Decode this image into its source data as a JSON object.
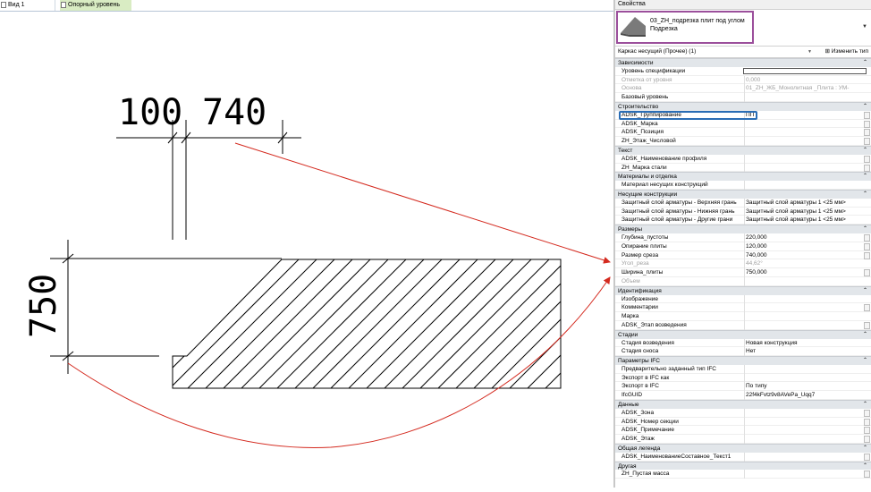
{
  "tabs": [
    {
      "label": "Вид 1"
    },
    {
      "label": "Опорный уровень"
    }
  ],
  "drawing": {
    "dim_top_left": "100",
    "dim_top_right": "740",
    "dim_left": "750"
  },
  "properties": {
    "title": "Свойства",
    "type_selector": {
      "family": "03_ZH_подрезка плит под углом",
      "type": "Подрезка"
    },
    "instance_filter": "Каркас несущий (Прочее) (1)",
    "edit_type": "Изменить тип",
    "groups": [
      {
        "name": "Зависимости",
        "rows": [
          {
            "label": "Уровень спецификации",
            "value": "",
            "input": true
          },
          {
            "label": "Отметка от уровня",
            "value": "0,000",
            "dim": true
          },
          {
            "label": "Основа",
            "value": "01_ZH_ЖБ_Монолитная _Плита : УМ-",
            "dim": true
          },
          {
            "label": "Базовый уровень",
            "value": ""
          }
        ]
      },
      {
        "name": "Строительство",
        "rows": [
          {
            "label": "ADSK_Группирование",
            "value": "ПП",
            "highlight": true,
            "chk": true
          },
          {
            "label": "ADSK_Марка",
            "value": "",
            "chk": true
          },
          {
            "label": "ADSK_Позиция",
            "value": "",
            "chk": true
          },
          {
            "label": "ZH_Этаж_Числовой",
            "value": "",
            "chk": true
          }
        ]
      },
      {
        "name": "Текст",
        "rows": [
          {
            "label": "ADSK_Наименование профиля",
            "value": "",
            "chk": true
          },
          {
            "label": "ZH_Марка стали",
            "value": "",
            "chk": true
          }
        ]
      },
      {
        "name": "Материалы и отделка",
        "rows": [
          {
            "label": "Материал несущих конструкций",
            "value": ""
          }
        ]
      },
      {
        "name": "Несущие конструкции",
        "rows": [
          {
            "label": "Защитный слой арматуры - Верхняя грань",
            "value": "Защитный слой арматуры 1 <25 мм>"
          },
          {
            "label": "Защитный слой арматуры - Нижняя грань",
            "value": "Защитный слой арматуры 1 <25 мм>"
          },
          {
            "label": "Защитный слой арматуры - Другие грани",
            "value": "Защитный слой арматуры 1 <25 мм>"
          }
        ]
      },
      {
        "name": "Размеры",
        "rows": [
          {
            "label": "Глубина_пустоты",
            "value": "220,000",
            "chk": true
          },
          {
            "label": "Опирание плиты",
            "value": "120,000",
            "chk": true
          },
          {
            "label": "Размер среза",
            "value": "740,000",
            "chk": true
          },
          {
            "label": "Угол_реза",
            "value": "44,62°",
            "dim": true
          },
          {
            "label": "Ширина_плиты",
            "value": "750,000",
            "chk": true
          },
          {
            "label": "Объем",
            "value": "",
            "dim": true
          }
        ]
      },
      {
        "name": "Идентификация",
        "rows": [
          {
            "label": "Изображение",
            "value": ""
          },
          {
            "label": "Комментарии",
            "value": "",
            "chk": true
          },
          {
            "label": "Марка",
            "value": ""
          },
          {
            "label": "ADSK_Этап возведения",
            "value": "",
            "chk": true
          }
        ]
      },
      {
        "name": "Стадии",
        "rows": [
          {
            "label": "Стадия возведения",
            "value": "Новая конструкция"
          },
          {
            "label": "Стадия сноса",
            "value": "Нет"
          }
        ]
      },
      {
        "name": "Параметры IFC",
        "rows": [
          {
            "label": "Предварительно заданный тип IFC",
            "value": ""
          },
          {
            "label": "Экспорт в IFC как",
            "value": ""
          },
          {
            "label": "Экспорт в IFC",
            "value": "По типу"
          },
          {
            "label": "IfcGUID",
            "value": "22f4kFvtz9v8AVePa_Uqq7"
          }
        ]
      },
      {
        "name": "Данные",
        "rows": [
          {
            "label": "ADSK_Зона",
            "value": "",
            "chk": true
          },
          {
            "label": "ADSK_Номер секции",
            "value": "",
            "chk": true
          },
          {
            "label": "ADSK_Примечание",
            "value": "",
            "chk": true
          },
          {
            "label": "ADSK_Этаж",
            "value": "",
            "chk": true
          }
        ]
      },
      {
        "name": "Общая легенда",
        "rows": [
          {
            "label": "ADSK_НаименованиеСоставное_Текст1",
            "value": "",
            "chk": true
          }
        ]
      },
      {
        "name": "Другая",
        "rows": [
          {
            "label": "ZH_Пустая масса",
            "value": "",
            "chk": true
          }
        ]
      }
    ]
  },
  "colors": {
    "tab_active": "#d9ecc3",
    "annotation_arrow": "#d42a1f",
    "type_box_border": "#9b4f9b",
    "highlight_border": "#2a6db5"
  }
}
